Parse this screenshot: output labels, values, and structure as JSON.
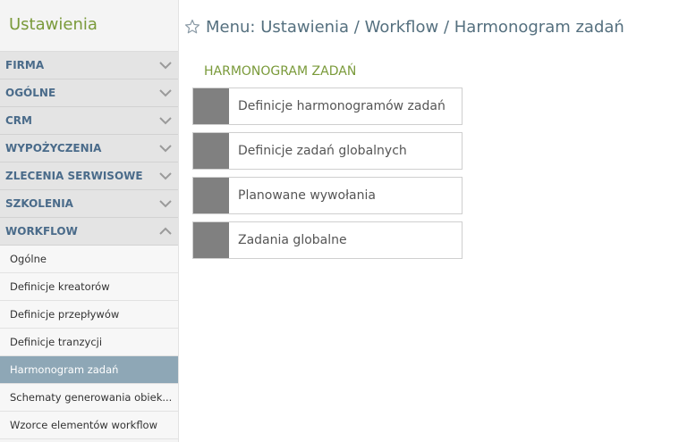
{
  "sidebar": {
    "title": "Ustawienia",
    "sections": [
      {
        "label": "FIRMA",
        "expanded": false
      },
      {
        "label": "OGÓLNE",
        "expanded": false
      },
      {
        "label": "CRM",
        "expanded": false
      },
      {
        "label": "WYPOŻYCZENIA",
        "expanded": false
      },
      {
        "label": "ZLECENIA SERWISOWE",
        "expanded": false
      },
      {
        "label": "SZKOLENIA",
        "expanded": false
      },
      {
        "label": "WORKFLOW",
        "expanded": true
      }
    ],
    "workflow_items": [
      {
        "label": "Ogólne"
      },
      {
        "label": "Definicje kreatorów"
      },
      {
        "label": "Definicje przepływów"
      },
      {
        "label": "Definicje tranzycji"
      },
      {
        "label": "Harmonogram zadań",
        "active": true
      },
      {
        "label": "Schematy generowania obiek..."
      },
      {
        "label": "Wzorce elementów workflow"
      }
    ]
  },
  "breadcrumb": {
    "text": "Menu: Ustawienia / Workflow / Harmonogram zadań"
  },
  "main": {
    "heading": "HARMONOGRAM ZADAŃ",
    "tiles": [
      {
        "label": "Definicje harmonogramów zadań"
      },
      {
        "label": "Definicje zadań globalnych"
      },
      {
        "label": "Planowane wywołania"
      },
      {
        "label": "Zadania globalne"
      }
    ]
  },
  "colors": {
    "accent_green": "#7a9a3a",
    "section_text": "#4a6b8a",
    "active_item_bg": "#8ea7b6",
    "tile_icon": "#808080"
  }
}
